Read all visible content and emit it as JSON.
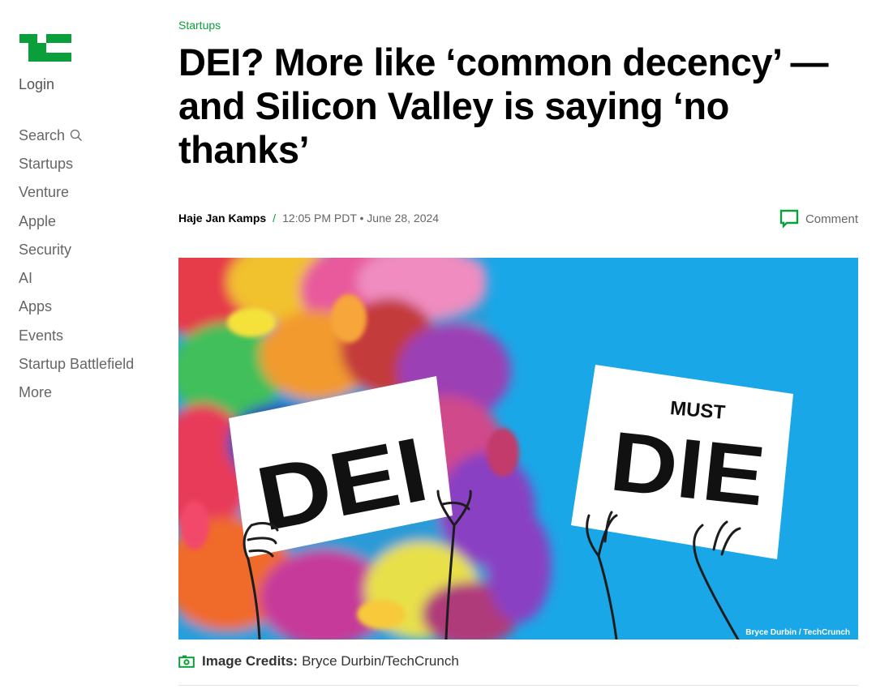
{
  "sidebar": {
    "logo_text": "TC",
    "login_label": "Login",
    "search_label": "Search",
    "nav_items": [
      {
        "label": "Startups"
      },
      {
        "label": "Venture"
      },
      {
        "label": "Apple"
      },
      {
        "label": "Security"
      },
      {
        "label": "AI"
      },
      {
        "label": "Apps"
      },
      {
        "label": "Events"
      },
      {
        "label": "Startup Battlefield"
      },
      {
        "label": "More"
      }
    ]
  },
  "article": {
    "category": "Startups",
    "title": "DEI? More like ‘common decency’ — and Silicon Valley is saying ‘no thanks’",
    "author": "Haje Jan Kamps",
    "separator": "/",
    "timestamp": "12:05 PM PDT • June 28, 2024",
    "comment_label": "Comment"
  },
  "hero": {
    "sign_left": "DEI",
    "sign_right_small": "MUST",
    "sign_right_big": "DIE",
    "credit_tag": "Bryce Durbin / TechCrunch"
  },
  "image_credits": {
    "label": "Image Credits:",
    "value": "Bryce Durbin/TechCrunch"
  },
  "colors": {
    "brand_green": "#0a9f3b",
    "hero_blue": "#1aa7e8"
  },
  "icons": [
    "tc-logo",
    "search-icon",
    "comment-icon",
    "camera-icon"
  ]
}
